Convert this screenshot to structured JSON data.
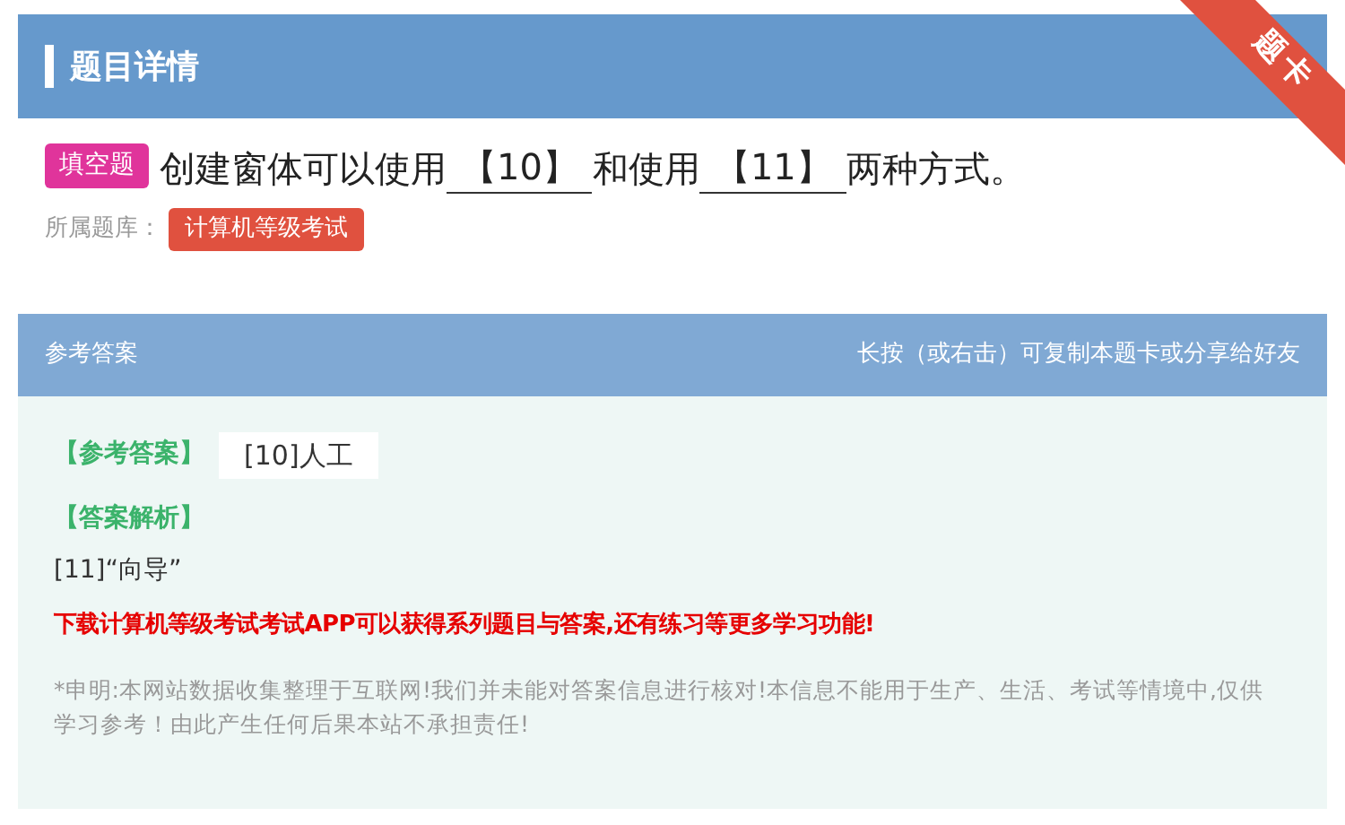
{
  "header": {
    "title": "题目详情"
  },
  "ribbon": {
    "label": "题卡"
  },
  "question": {
    "type_tag": "填空题",
    "parts": [
      {
        "kind": "text",
        "text": "创建窗体可以使用"
      },
      {
        "kind": "blank",
        "text": "【10】"
      },
      {
        "kind": "text",
        "text": "和使用"
      },
      {
        "kind": "blank",
        "text": "【11】"
      },
      {
        "kind": "text",
        "text": "两种方式。"
      }
    ]
  },
  "bank": {
    "label": "所属题库：",
    "tag": "计算机等级考试"
  },
  "answer_header": {
    "title": "参考答案",
    "hint": "长按（或右击）可复制本题卡或分享给好友"
  },
  "answer": {
    "label": "【参考答案】",
    "image_text": "[10]人工"
  },
  "analysis": {
    "label": "【答案解析】",
    "text": "[11]“向导”"
  },
  "promo": "下载计算机等级考试考试APP可以获得系列题目与答案,还有练习等更多学习功能!",
  "disclaimer": "*申明:本网站数据收集整理于互联网!我们并未能对答案信息进行核对!本信息不能用于生产、生活、考试等情境中,仅供学习参考！由此产生任何后果本站不承担责任!"
}
